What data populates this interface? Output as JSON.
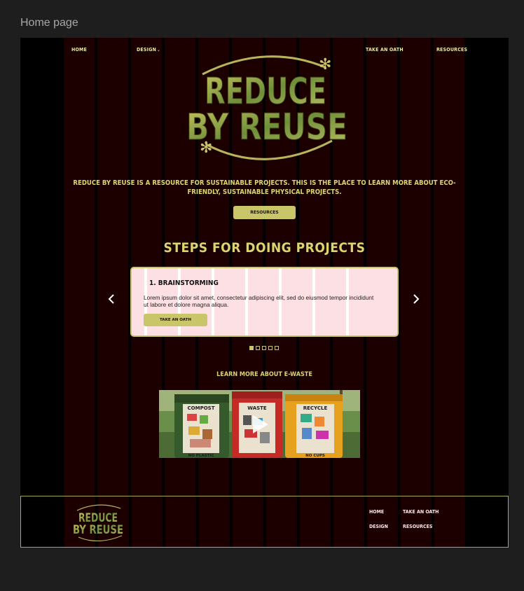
{
  "frame_label": "Home page",
  "nav": {
    "home": "Home",
    "design": "Design",
    "design_caret": "⌄",
    "take_oath": "Take an oath",
    "resources": "Resources"
  },
  "logo": {
    "line1": "REDUCE",
    "line2": "BY REUSE"
  },
  "intro": "Reduce by Reuse is a resource for sustainable projects. This is the place to learn more about eco-friendly, sustainable physical projects.",
  "resources_button": "Resources",
  "steps_heading": "Steps for doing projects",
  "carousel": {
    "card_title": "1. Brainstorming",
    "card_text": "Lorem ipsum dolor sit amet, consectetur adipiscing elit, sed do eiusmod tempor incididunt ut labore et dolore magna aliqua.",
    "card_button": "Take an oath",
    "prev_icon": "chevron-left-icon",
    "next_icon": "chevron-right-icon",
    "dots_total": 5,
    "active_dot": 1
  },
  "ewaste_heading": "Learn more about e-waste",
  "video": {
    "bins": [
      "COMPOST",
      "WASTE",
      "RECYCLE"
    ],
    "bin_footers": [
      "NO PLASTIC",
      "",
      "NO CUPS"
    ],
    "play_icon": "play-icon"
  },
  "footer": {
    "logo_line1": "REDUCE",
    "logo_line2": "BY REUSE",
    "home": "Home",
    "take_oath": "Take an oath",
    "design": "Design",
    "resources": "Resources"
  },
  "colors": {
    "accent": "#c9c66a",
    "logo_green": "#8a9a40",
    "heading_yellow": "#d9d56f",
    "stripe_dark_red": "#1c0000",
    "card_pink": "#fde0e3"
  }
}
